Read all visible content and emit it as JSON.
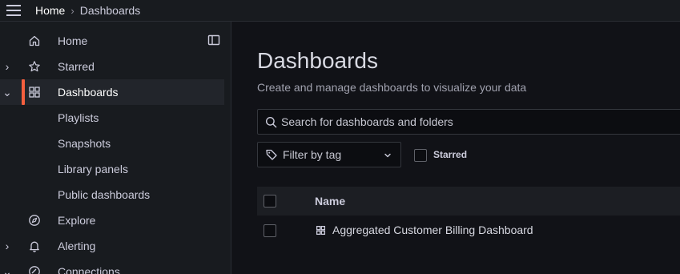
{
  "breadcrumb": {
    "home": "Home",
    "separator": "›",
    "current": "Dashboards"
  },
  "sidebar": {
    "items": [
      {
        "label": "Home",
        "icon": "home-icon"
      },
      {
        "label": "Starred",
        "icon": "star-icon",
        "chevron": "›"
      },
      {
        "label": "Dashboards",
        "icon": "grid-icon",
        "chevron": "⌄",
        "active": true
      },
      {
        "label": "Playlists"
      },
      {
        "label": "Snapshots"
      },
      {
        "label": "Library panels"
      },
      {
        "label": "Public dashboards"
      },
      {
        "label": "Explore",
        "icon": "compass-icon"
      },
      {
        "label": "Alerting",
        "icon": "bell-icon",
        "chevron": "›"
      },
      {
        "label": "Connections",
        "icon": "connections-icon",
        "chevron": "⌄"
      }
    ]
  },
  "main": {
    "title": "Dashboards",
    "subtitle": "Create and manage dashboards to visualize your data",
    "search_placeholder": "Search for dashboards and folders",
    "filter_label": "Filter by tag",
    "starred_label": "Starred",
    "table": {
      "header": "Name",
      "rows": [
        {
          "name": "Aggregated Customer Billing Dashboard"
        }
      ]
    }
  },
  "colors": {
    "accent": "#f55f3e",
    "background": "#111217",
    "sidebar": "#181b1f"
  }
}
